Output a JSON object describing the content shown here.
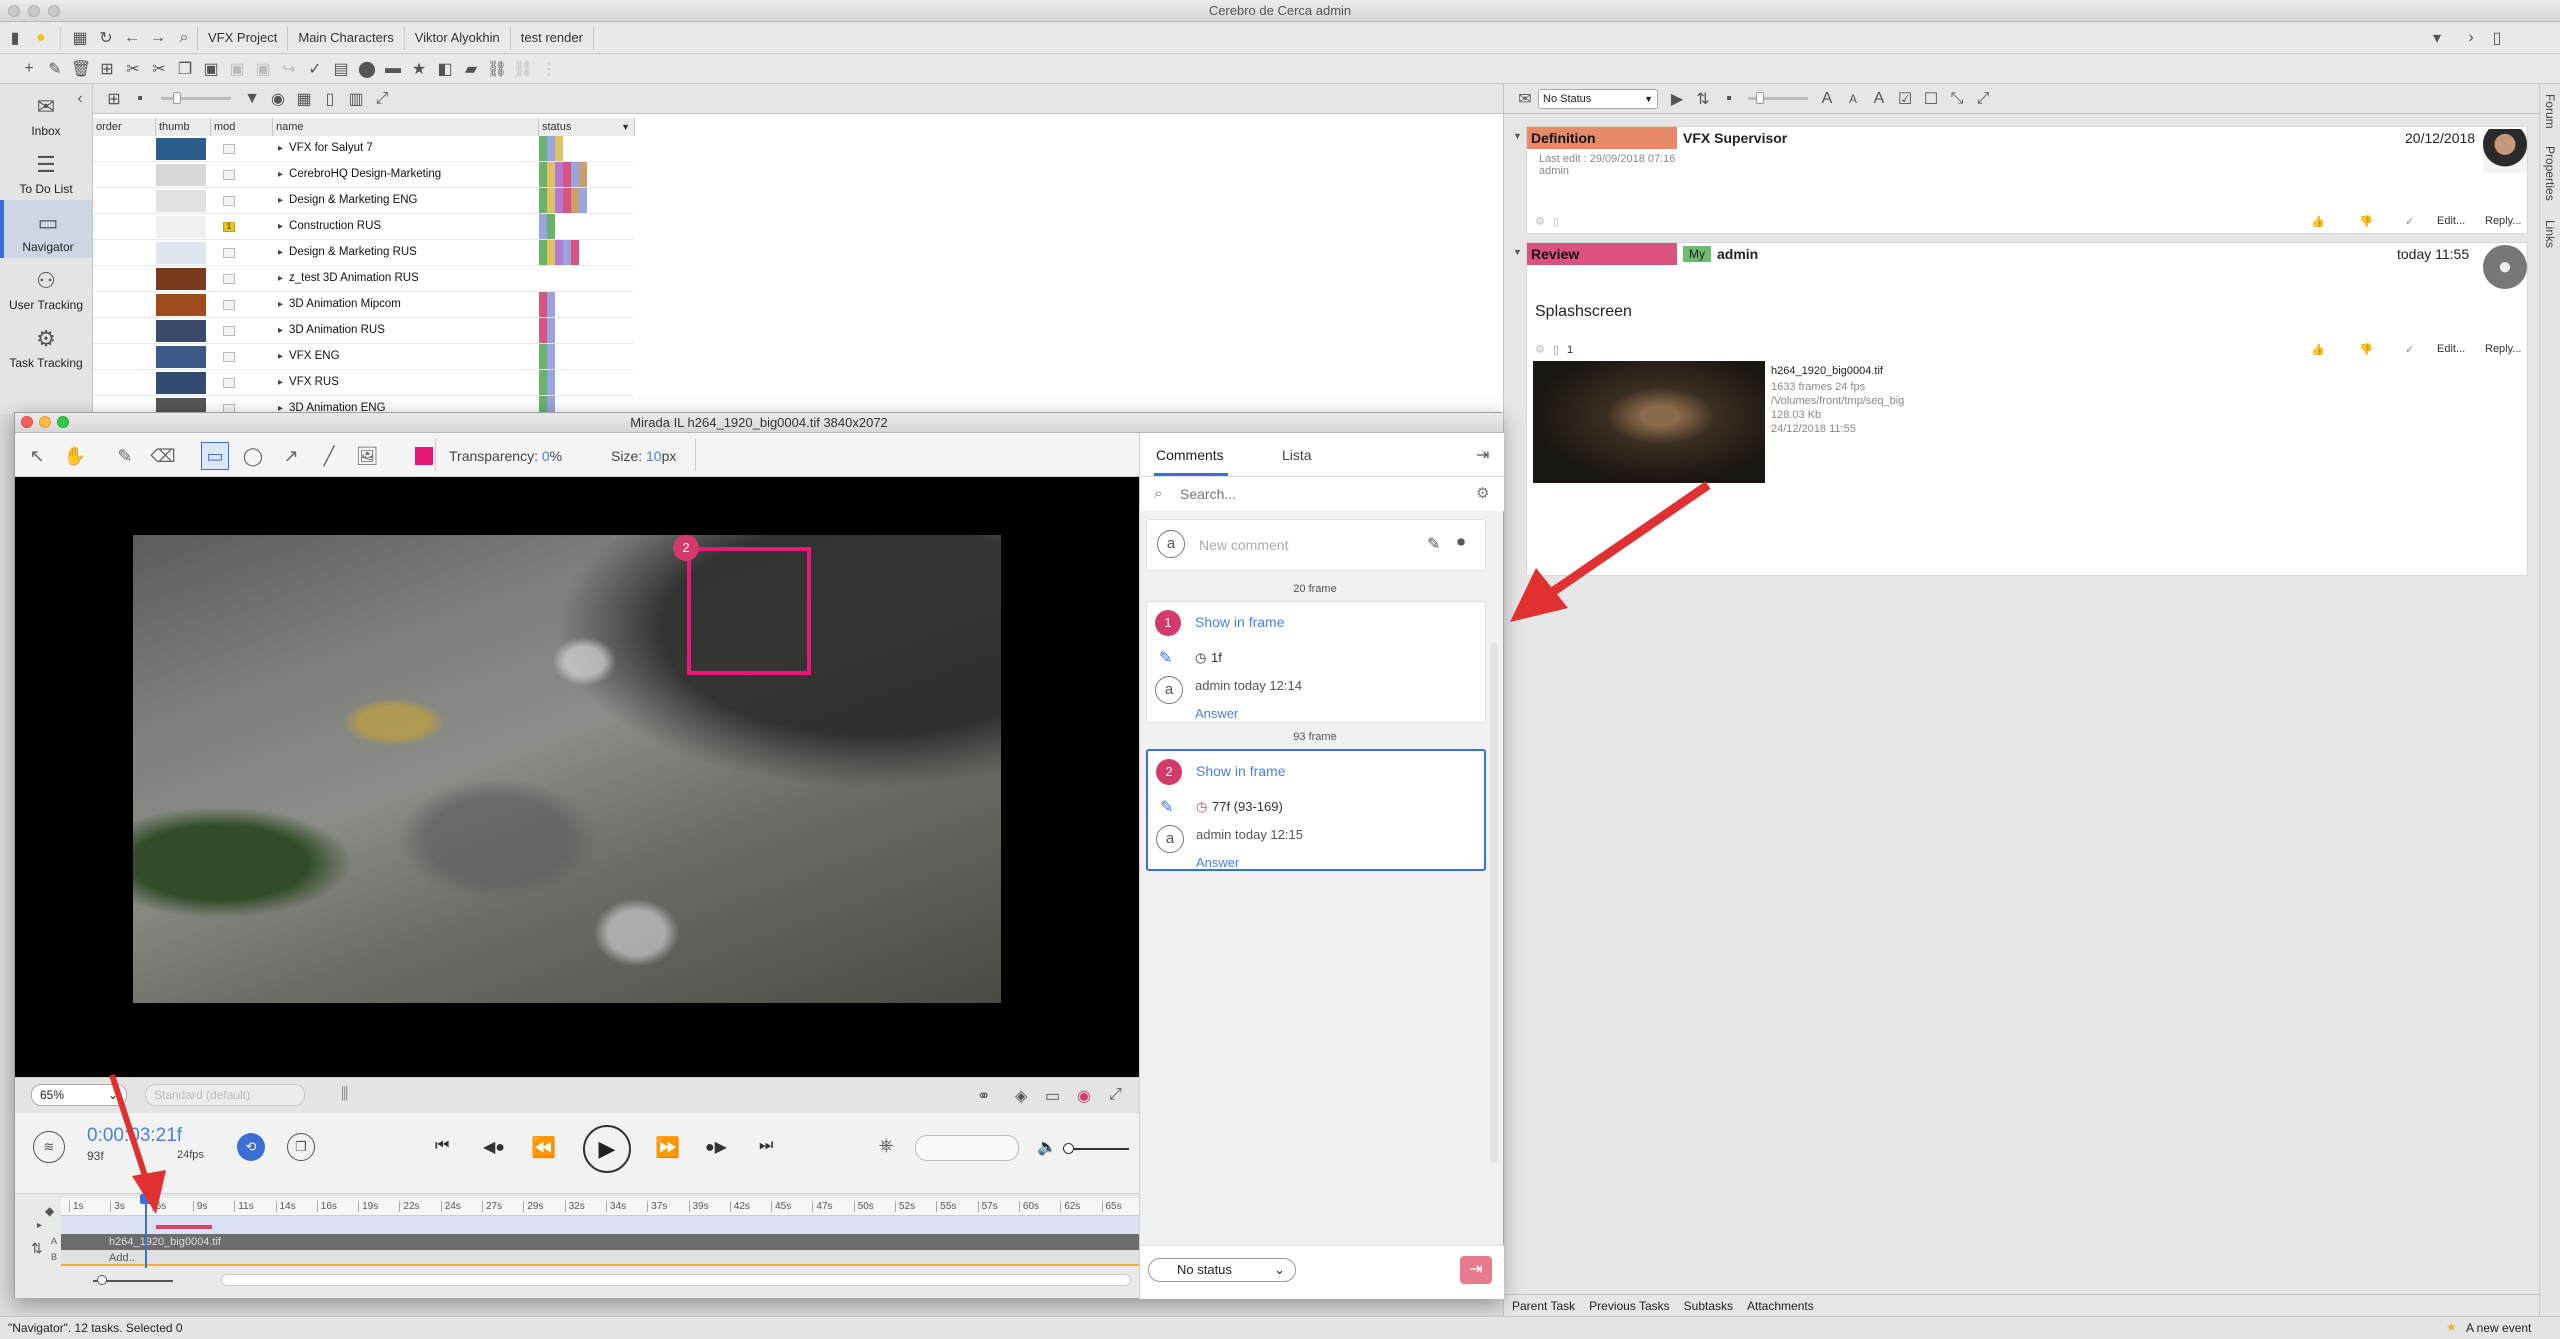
{
  "app": {
    "title": "Cerebro de Cerca  admin"
  },
  "breadcrumbs": [
    "VFX Project",
    "Main Characters",
    "Viktor Alyokhin",
    "test render"
  ],
  "sidebar": {
    "items": [
      {
        "label": "Inbox",
        "icon": "inbox-icon"
      },
      {
        "label": "To Do List",
        "icon": "list-icon"
      },
      {
        "label": "Navigator",
        "icon": "folder-icon"
      },
      {
        "label": "User Tracking",
        "icon": "users-icon"
      },
      {
        "label": "Task Tracking",
        "icon": "tasks-icon"
      }
    ]
  },
  "navigator": {
    "columns": [
      "order",
      "thumb",
      "mod",
      "name",
      "status"
    ],
    "rows": [
      {
        "name": "VFX for Salyut 7",
        "thumb": "#2b5d8a",
        "mod": false
      },
      {
        "name": "CerebroHQ Design-Marketing",
        "thumb": "#d8d8d8",
        "mod": false
      },
      {
        "name": "Design & Marketing ENG",
        "thumb": "#e0e0e0",
        "mod": false
      },
      {
        "name": "Construction RUS",
        "thumb": "#f0f0f0",
        "mod": true,
        "mod_badge": "1"
      },
      {
        "name": "Design & Marketing RUS",
        "thumb": "#dfe6f0",
        "mod": false
      },
      {
        "name": "z_test 3D Animation RUS",
        "thumb": "#7a3a1e",
        "mod": false
      },
      {
        "name": "3D Animation Mipcom",
        "thumb": "#a04a20",
        "mod": false
      },
      {
        "name": "3D Animation RUS",
        "thumb": "#3a4a6a",
        "mod": false
      },
      {
        "name": "VFX ENG",
        "thumb": "#3b5a8a",
        "mod": false
      },
      {
        "name": "VFX RUS",
        "thumb": "#334b73",
        "mod": false
      },
      {
        "name": "3D Animation ENG",
        "thumb": "#555",
        "mod": false
      }
    ]
  },
  "right_panel": {
    "status_select": "No Status",
    "definition": {
      "tag": "Definition",
      "role": "VFX Supervisor",
      "date": "20/12/2018",
      "last_edit": "Last edit : 29/09/2018 07:16",
      "author": "admin",
      "edit": "Edit...",
      "reply": "Reply..."
    },
    "review": {
      "tag": "Review",
      "my": "My",
      "user": "admin",
      "date": "today 11:55",
      "title": "Splashscreen",
      "attach_count": "1",
      "file_name": "h264_1920_big0004.tif",
      "file_frames": "1633 frames 24 fps",
      "file_path": "/Volumes/front/tmp/seq_big",
      "file_size": "128.03 Kb",
      "file_date": "24/12/2018 11:55",
      "edit": "Edit...",
      "reply": "Reply..."
    },
    "side_tabs": [
      "Forum",
      "Properties",
      "Links"
    ],
    "bottom_tabs": [
      "Parent Task",
      "Previous Tasks",
      "Subtasks",
      "Attachments"
    ]
  },
  "mirada": {
    "title": "Mirada IL    h264_1920_big0004.tif 3840x2072",
    "transparency_label": "Transparency:",
    "transparency_value": "0",
    "transparency_unit": "%",
    "size_label": "Size:",
    "size_value": "10",
    "size_unit": "px",
    "draw_color": "#e8177a",
    "zoom": "65%",
    "view_mode": "Standard (default)",
    "timecode": "0:00:03:21f",
    "frame": "93f",
    "fps": "24fps",
    "timeline_ticks": [
      "1s",
      "3s",
      "6s",
      "9s",
      "11s",
      "14s",
      "16s",
      "19s",
      "22s",
      "24s",
      "27s",
      "29s",
      "32s",
      "34s",
      "37s",
      "39s",
      "42s",
      "45s",
      "47s",
      "50s",
      "52s",
      "55s",
      "57s",
      "60s",
      "62s",
      "65s"
    ],
    "track_name": "h264_1920_big0004.tif",
    "add_label": "Add..",
    "annotation_number": "2"
  },
  "comments": {
    "tabs": [
      "Comments",
      "Lista"
    ],
    "search_placeholder": "Search...",
    "new_placeholder": "New comment",
    "groups": [
      {
        "frame_label": "20 frame",
        "number": "1",
        "show": "Show in frame",
        "duration": "1f",
        "author_line": "admin today 12:14",
        "answer": "Answer"
      },
      {
        "frame_label": "93 frame",
        "number": "2",
        "show": "Show in frame",
        "duration": "77f (93-169)",
        "author_line": "admin today 12:15",
        "answer": "Answer"
      }
    ],
    "status_select": "No status"
  },
  "statusbar": {
    "left": "\"Navigator\". 12 tasks. Selected 0",
    "right": "A new event"
  }
}
